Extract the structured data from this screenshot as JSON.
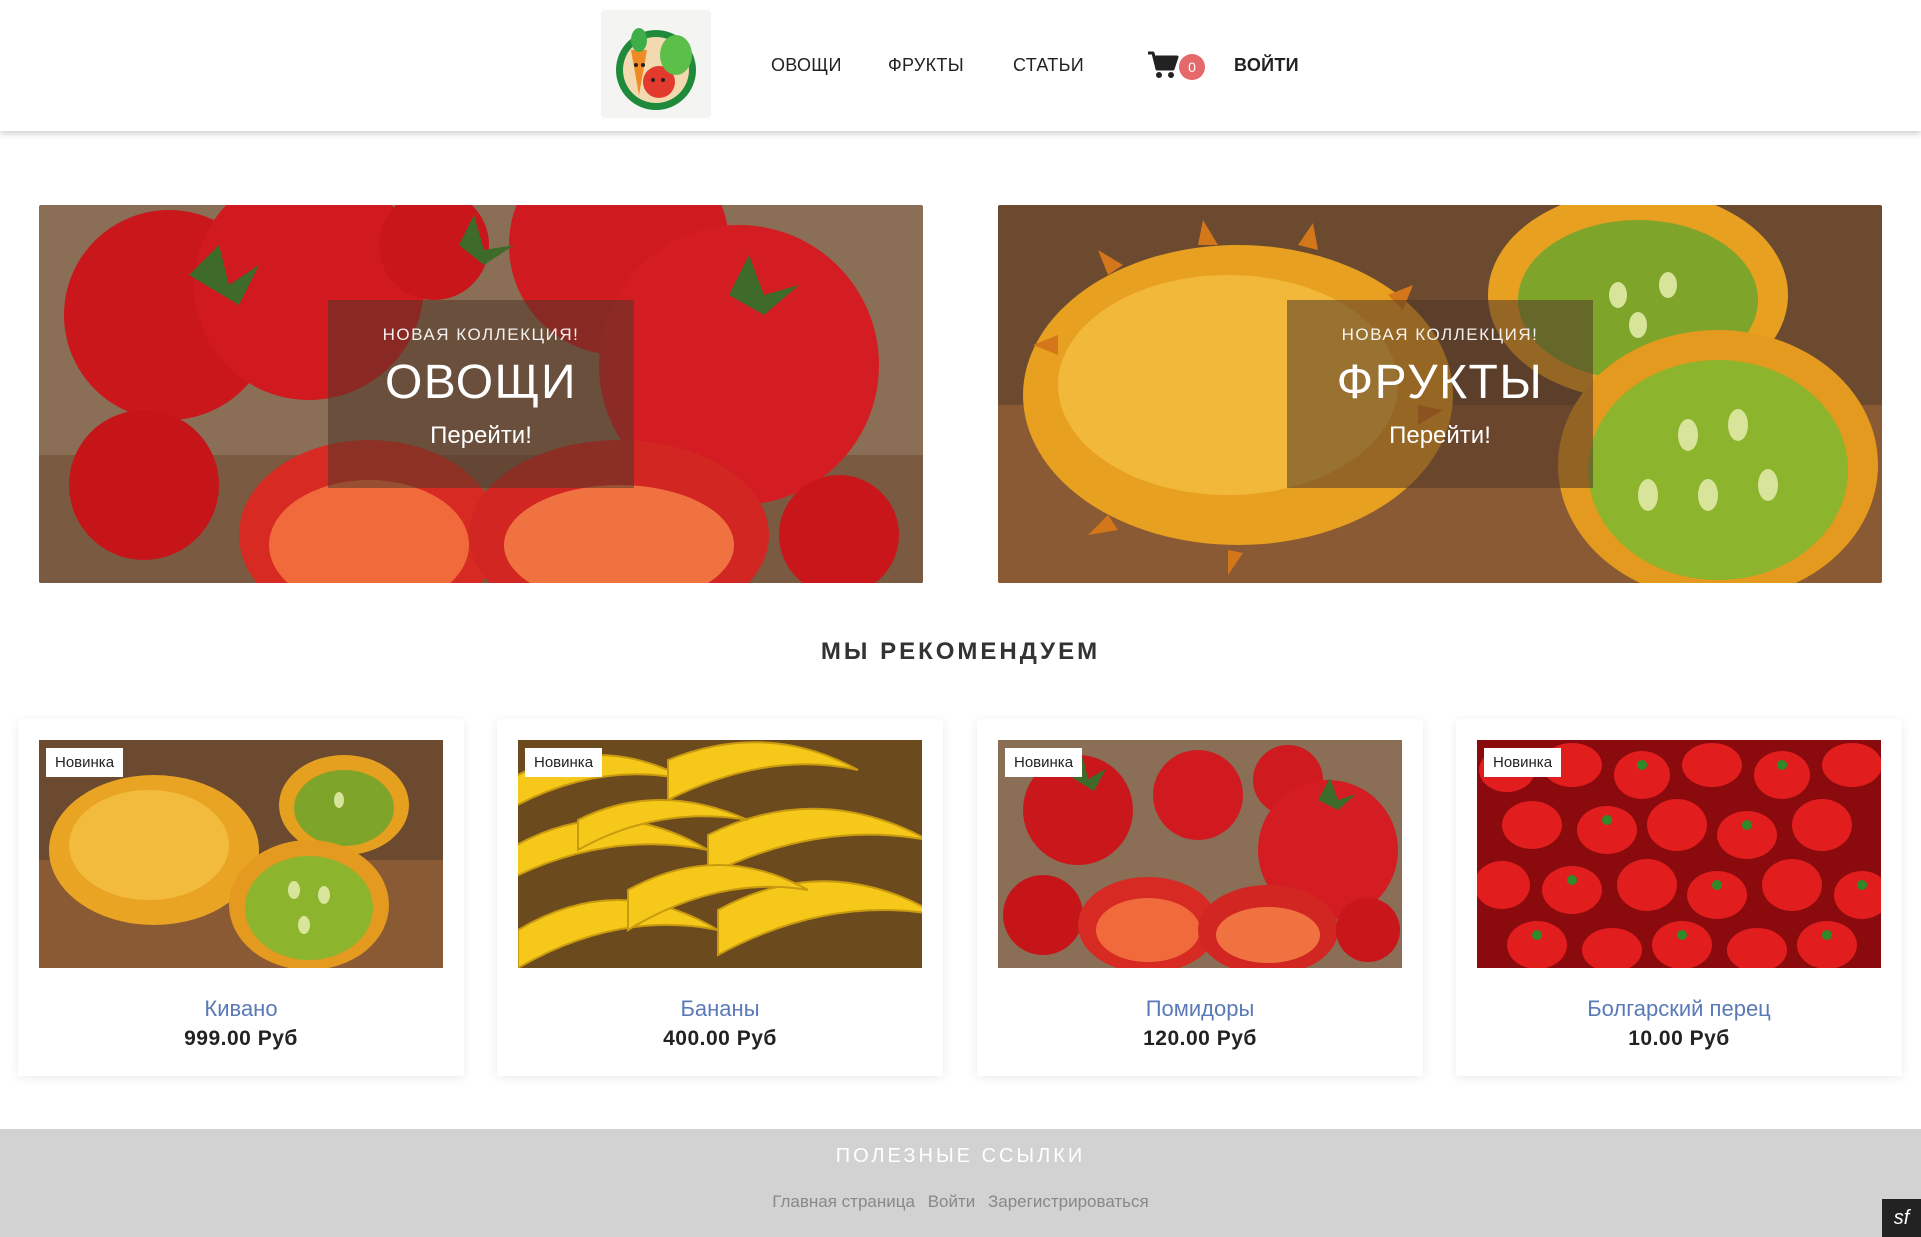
{
  "header": {
    "nav": [
      {
        "label": "ОВОЩИ"
      },
      {
        "label": "ФРУКТЫ"
      },
      {
        "label": "СТАТЬИ"
      }
    ],
    "cart_count": "0",
    "login_label": "ВОЙТИ"
  },
  "banners": [
    {
      "kicker": "НОВАЯ КОЛЛЕКЦИЯ!",
      "title": "ОВОЩИ",
      "link": "Перейти!"
    },
    {
      "kicker": "НОВАЯ КОЛЛЕКЦИЯ!",
      "title": "ФРУКТЫ",
      "link": "Перейти!"
    }
  ],
  "recommended": {
    "title": "МЫ РЕКОМЕНДУЕМ",
    "products": [
      {
        "badge": "Новинка",
        "name": "Кивано",
        "price": "999.00 Руб"
      },
      {
        "badge": "Новинка",
        "name": "Бананы",
        "price": "400.00 Руб"
      },
      {
        "badge": "Новинка",
        "name": "Помидоры",
        "price": "120.00 Руб"
      },
      {
        "badge": "Новинка",
        "name": "Болгарский перец",
        "price": "10.00 Руб"
      }
    ]
  },
  "footer": {
    "title": "ПОЛЕЗНЫЕ ССЫЛКИ",
    "links": [
      "Главная страница",
      "Войти",
      "Зарегистрироваться"
    ]
  },
  "colors": {
    "accent_link": "#5a79b7",
    "cart_badge": "#e5686a",
    "footer_bg": "#d2d2d2"
  },
  "icons": [
    "logo-icon",
    "cart-icon",
    "symfony-toolbar-icon"
  ]
}
